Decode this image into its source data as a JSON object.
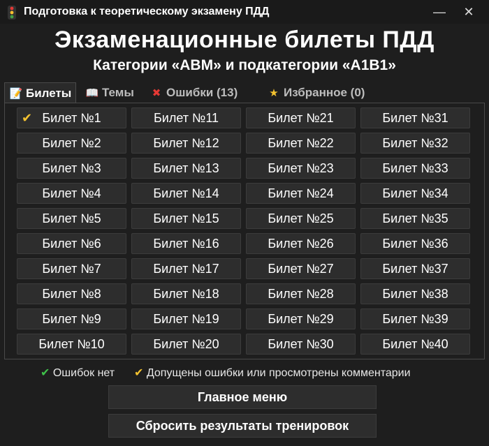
{
  "window": {
    "title": "Подготовка к теоретическому экзамену ПДД",
    "minimize": "—",
    "close": "✕"
  },
  "header": {
    "title": "Экзаменационные билеты ПДД",
    "subtitle": "Категории «ABM» и подкатегории «A1B1»"
  },
  "tabs": [
    {
      "label": "Билеты",
      "icon": "notepad-icon"
    },
    {
      "label": "Темы",
      "icon": "book-icon"
    },
    {
      "label": "Ошибки (13)",
      "icon": "error-doc-icon"
    },
    {
      "label": "Избранное (0)",
      "icon": "star-icon"
    }
  ],
  "tickets": [
    "Билет №1",
    "Билет №11",
    "Билет №21",
    "Билет №31",
    "Билет №2",
    "Билет №12",
    "Билет №22",
    "Билет №32",
    "Билет №3",
    "Билет №13",
    "Билет №23",
    "Билет №33",
    "Билет №4",
    "Билет №14",
    "Билет №24",
    "Билет №34",
    "Билет №5",
    "Билет №15",
    "Билет №25",
    "Билет №35",
    "Билет №6",
    "Билет №16",
    "Билет №26",
    "Билет №36",
    "Билет №7",
    "Билет №17",
    "Билет №27",
    "Билет №37",
    "Билет №8",
    "Билет №18",
    "Билет №28",
    "Билет №38",
    "Билет №9",
    "Билет №19",
    "Билет №29",
    "Билет №39",
    "Билет №10",
    "Билет №20",
    "Билет №30",
    "Билет №40"
  ],
  "ticket_marked": "Билет №1",
  "legend": {
    "no_errors": "Ошибок нет",
    "with_errors": "Допущены ошибки или просмотрены комментарии"
  },
  "buttons": {
    "main_menu": "Главное меню",
    "reset": "Сбросить результаты тренировок"
  },
  "colors": {
    "background": "#1e1e1e",
    "button": "#2d2d2d",
    "check_yellow": "#f3c230",
    "check_green": "#3fc24a"
  }
}
